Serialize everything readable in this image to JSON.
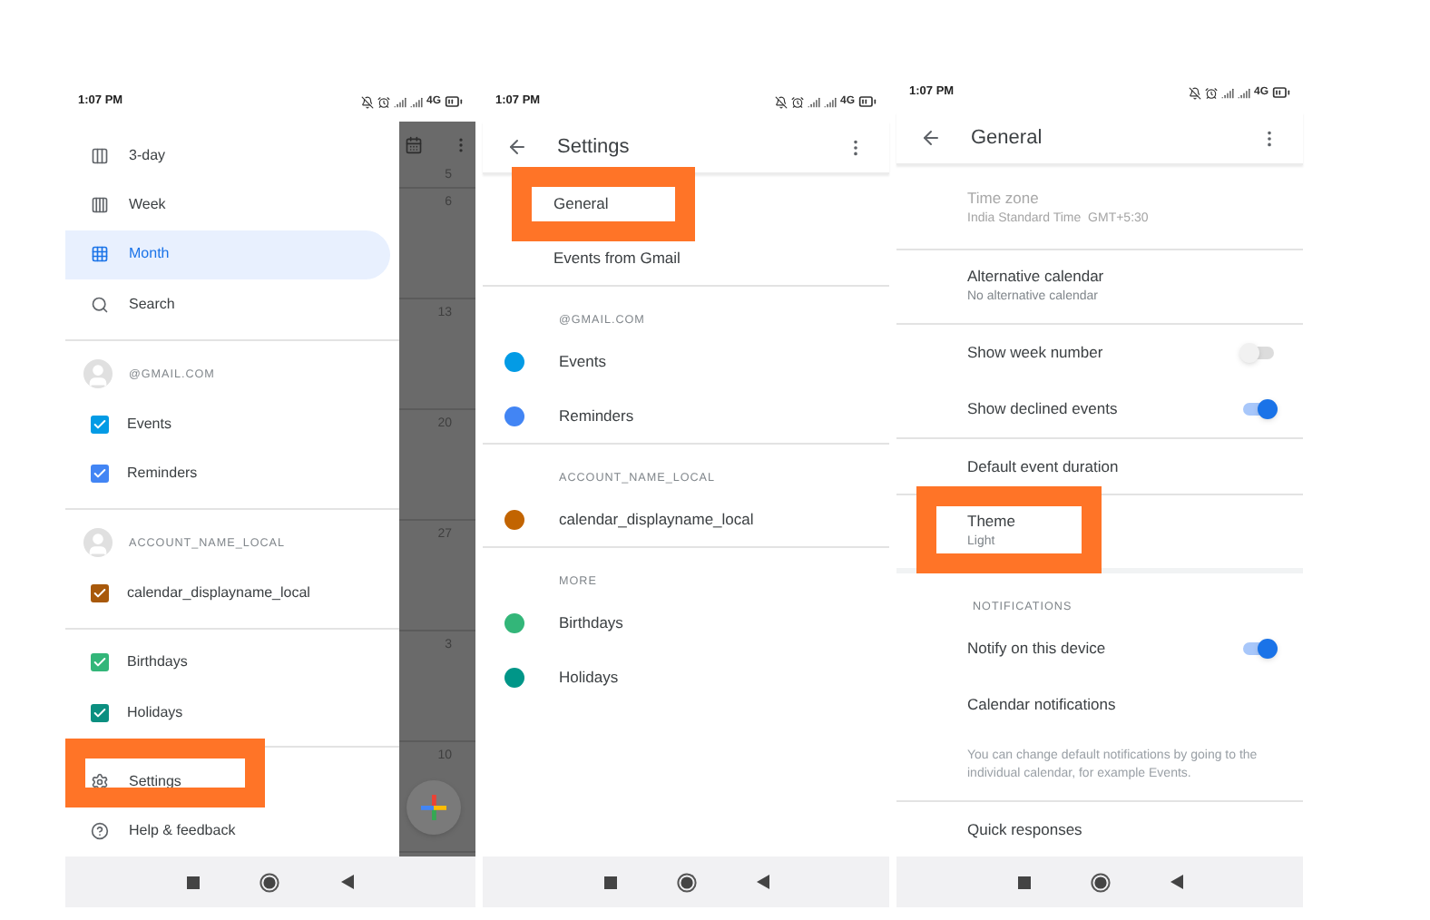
{
  "panels": [
    {
      "kind": "drawer",
      "status": {
        "time": "1:07 PM",
        "network": "4G"
      },
      "items": [
        {
          "kind": "view",
          "label": "3-day",
          "selected": false
        },
        {
          "kind": "view",
          "label": "Week",
          "selected": false
        },
        {
          "kind": "view",
          "label": "Month",
          "selected": true
        },
        {
          "kind": "view",
          "label": "Search",
          "selected": false
        },
        {
          "kind": "divider"
        },
        {
          "kind": "account",
          "label": "@GMAIL.COM"
        },
        {
          "kind": "calendar",
          "label": "Events",
          "color": "#039be5",
          "checked": true
        },
        {
          "kind": "calendar",
          "label": "Reminders",
          "color": "#4285f4",
          "checked": true
        },
        {
          "kind": "divider"
        },
        {
          "kind": "account",
          "label": "ACCOUNT_NAME_LOCAL"
        },
        {
          "kind": "calendar",
          "label": "calendar_displayname_local",
          "color": "#a8590b",
          "checked": true
        },
        {
          "kind": "divider"
        },
        {
          "kind": "calendar",
          "label": "Birthdays",
          "color": "#33b679",
          "checked": true
        },
        {
          "kind": "calendar",
          "label": "Holidays",
          "color": "#0b8f80",
          "checked": true
        },
        {
          "kind": "divider"
        },
        {
          "kind": "view",
          "label": "Settings",
          "selected": false,
          "highlighted": true
        },
        {
          "kind": "view",
          "label": "Help & feedback",
          "selected": false
        }
      ],
      "calendar_strip": {
        "dates": [
          "5",
          "6",
          "13",
          "20",
          "27",
          "3",
          "10"
        ]
      }
    },
    {
      "kind": "settings",
      "status": {
        "time": "1:07 PM",
        "network": "4G"
      },
      "title": "Settings",
      "items": [
        {
          "kind": "row",
          "label": "General",
          "highlighted": true
        },
        {
          "kind": "row",
          "label": "Events from Gmail"
        },
        {
          "kind": "divider"
        },
        {
          "kind": "header",
          "label": "@GMAIL.COM"
        },
        {
          "kind": "calendar",
          "label": "Events",
          "color": "#039be5"
        },
        {
          "kind": "calendar",
          "label": "Reminders",
          "color": "#4285f4"
        },
        {
          "kind": "divider"
        },
        {
          "kind": "header",
          "label": "ACCOUNT_NAME_LOCAL"
        },
        {
          "kind": "calendar",
          "label": "calendar_displayname_local",
          "color": "#c26401"
        },
        {
          "kind": "divider"
        },
        {
          "kind": "header",
          "label": "MORE"
        },
        {
          "kind": "calendar",
          "label": "Birthdays",
          "color": "#33b679"
        },
        {
          "kind": "calendar",
          "label": "Holidays",
          "color": "#009688"
        }
      ]
    },
    {
      "kind": "settings",
      "status": {
        "time": "1:07 PM",
        "network": "4G"
      },
      "title": "General",
      "items": [
        {
          "kind": "row",
          "label": "Time zone",
          "sublabel": "India Standard Time  GMT+5:30",
          "disabled": true
        },
        {
          "kind": "divider"
        },
        {
          "kind": "row",
          "label": "Alternative calendar",
          "sublabel": "No alternative calendar"
        },
        {
          "kind": "divider"
        },
        {
          "kind": "toggle",
          "label": "Show week number",
          "on": false
        },
        {
          "kind": "toggle",
          "label": "Show declined events",
          "on": true
        },
        {
          "kind": "divider"
        },
        {
          "kind": "row",
          "label": "Default event duration"
        },
        {
          "kind": "divider"
        },
        {
          "kind": "row",
          "label": "Theme",
          "sublabel": "Light",
          "highlighted": true
        },
        {
          "kind": "section-gap"
        },
        {
          "kind": "header",
          "label": "NOTIFICATIONS"
        },
        {
          "kind": "toggle",
          "label": "Notify on this device",
          "on": true
        },
        {
          "kind": "row",
          "label": "Calendar notifications"
        },
        {
          "kind": "note",
          "label": "You can change default notifications by going to the individual calendar, for example Events."
        },
        {
          "kind": "divider"
        },
        {
          "kind": "row",
          "label": "Quick responses"
        }
      ]
    }
  ]
}
